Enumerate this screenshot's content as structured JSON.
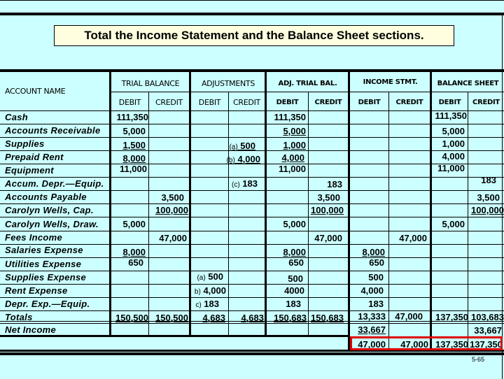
{
  "title": "Total the Income Statement and the Balance Sheet sections.",
  "slide_number": "5-65",
  "headers": {
    "account_name": "ACCOUNT NAME",
    "groups": [
      "TRIAL BALANCE",
      "ADJUSTMENTS",
      "ADJ. TRIAL BAL.",
      "INCOME STMT.",
      "BALANCE SHEET"
    ],
    "debit": "DEBIT",
    "credit": "CREDIT"
  },
  "accounts": [
    "Cash",
    "Accounts Receivable",
    "Supplies",
    "Prepaid Rent",
    "Equipment",
    "Accum. Depr.—Equip.",
    "Accounts Payable",
    "Carolyn Wells, Cap.",
    "Carolyn Wells, Draw.",
    "Fees Income",
    "Salaries Expense",
    "Utilities Expense",
    "Supplies Expense",
    "Rent Expense",
    "Depr. Exp.—Equip.",
    "Totals",
    "Net Income"
  ],
  "trial_balance": {
    "debit": {
      "Cash": "111,350",
      "Accounts Receivable": "5,000",
      "Supplies": "1,500",
      "Prepaid Rent": "8,000",
      "Equipment": "11,000",
      "Carolyn Wells, Draw.": "5,000",
      "Salaries Expense": "8,000",
      "Utilities Expense": "650",
      "Totals": "150,500"
    },
    "credit": {
      "Accounts Payable": "3,500",
      "Carolyn Wells, Cap.": "100,000",
      "Fees Income": "47,000",
      "Totals": "150,500"
    }
  },
  "adjustments": {
    "debit": [
      {
        "ref": "(a)",
        "value": "500",
        "account": "Supplies Expense"
      },
      {
        "ref": "b)",
        "value": "4,000",
        "account": "Rent Expense"
      },
      {
        "ref": "c)",
        "value": "183",
        "account": "Depr. Exp.—Equip."
      },
      {
        "ref": "",
        "value": "4,683",
        "account": "Totals"
      }
    ],
    "credit": [
      {
        "ref": "(a)",
        "value": "500",
        "account": "Supplies"
      },
      {
        "ref": "(b)",
        "value": "4,000",
        "account": "Prepaid Rent"
      },
      {
        "ref": "(c)",
        "value": "183",
        "account": "Accum. Depr.—Equip."
      },
      {
        "ref": "",
        "value": "4,683",
        "account": "Totals"
      }
    ]
  },
  "adj_trial_balance": {
    "debit": [
      "111,350",
      "5,000",
      "1,000",
      "4,000",
      "11,000",
      "5,000",
      "8,000",
      "650",
      "500",
      "4000",
      "183",
      "150,683"
    ],
    "credit": [
      "183",
      "3,500",
      "100,000",
      "47,000",
      "150,683"
    ]
  },
  "income_statement": {
    "debit": [
      "8,000",
      "650",
      "500",
      "4,000",
      "183",
      "13,333",
      "33,667",
      "47,000"
    ],
    "credit": [
      "47,000",
      "47,000",
      "47,000"
    ]
  },
  "balance_sheet": {
    "debit": [
      "111,350",
      "5,000",
      "1,000",
      "4,000",
      "11,000",
      "5,000",
      "137,350",
      "137,350"
    ],
    "credit": [
      "183",
      "3,500",
      "100,000",
      "103,683",
      "33,667",
      "137,350"
    ]
  },
  "colors": {
    "background": "#ccffff",
    "title_box": "#ffffe0",
    "highlight": "#e00000"
  }
}
